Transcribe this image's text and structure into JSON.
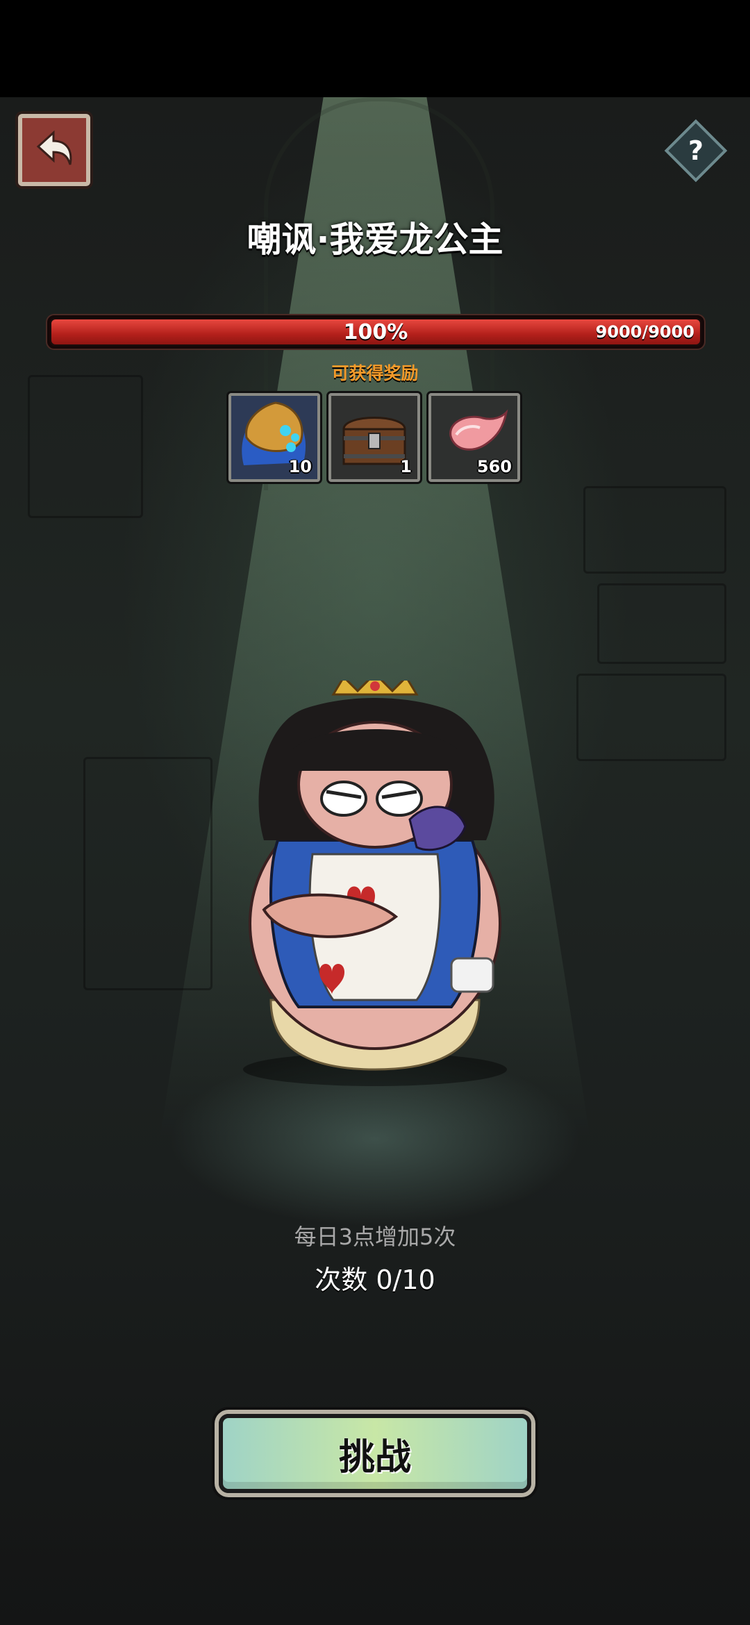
{
  "header": {
    "title": "嘲讽·我爱龙公主"
  },
  "boss_hp": {
    "percent_label": "100%",
    "value_label": "9000/9000",
    "fill_fraction": 1.0,
    "color": "#c4261f"
  },
  "rewards": {
    "label": "可获得奖励",
    "items": [
      {
        "icon": "golden-mask-icon",
        "count": "10"
      },
      {
        "icon": "treasure-chest-icon",
        "count": "1"
      },
      {
        "icon": "pink-meat-icon",
        "count": "560"
      }
    ]
  },
  "attempts": {
    "refresh_note": "每日3点增加5次",
    "count_label": "次数 0/10"
  },
  "actions": {
    "challenge_label": "挑战"
  },
  "colors": {
    "accent_orange": "#f39a2a",
    "button_green": "#c8e7a6",
    "back_button_red": "#8c3a33"
  }
}
